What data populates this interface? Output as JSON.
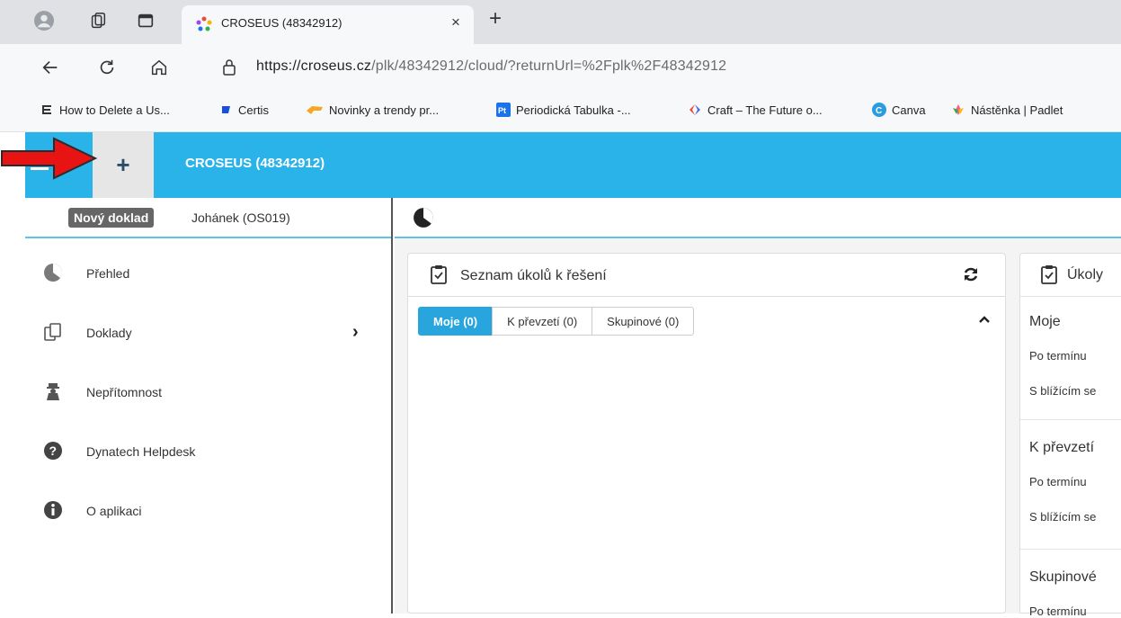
{
  "browser": {
    "tab_title": "CROSEUS (48342912)",
    "tab_close": "×",
    "new_tab": "+",
    "url_host": "https://croseus.cz",
    "url_path": "/plk/48342912/cloud/?returnUrl=%2Fplk%2F48342912",
    "bookmarks": [
      {
        "label": "How to Delete a Us...",
        "icon": "e-icon"
      },
      {
        "label": "Certis",
        "icon": "blue-flag-icon"
      },
      {
        "label": "Novinky a trendy pr...",
        "icon": "hand-icon"
      },
      {
        "label": "Periodická Tabulka -...",
        "icon": "pt-icon"
      },
      {
        "label": "Craft – The Future o...",
        "icon": "craft-icon"
      },
      {
        "label": "Canva",
        "icon": "canva-icon"
      },
      {
        "label": "Nástěnka | Padlet",
        "icon": "padlet-icon"
      }
    ]
  },
  "app": {
    "header_title": "CROSEUS (48342912)",
    "plus_label": "+",
    "tooltip": "Nový doklad",
    "user": "Johánek (OS019)",
    "accent": "#29b3e8",
    "sidebar": [
      {
        "label": "Přehled",
        "icon": "overview-icon"
      },
      {
        "label": "Doklady",
        "icon": "documents-icon",
        "chevron": "›"
      },
      {
        "label": "Nepřítomnost",
        "icon": "absence-icon"
      },
      {
        "label": "Dynatech Helpdesk",
        "icon": "help-icon"
      },
      {
        "label": "O aplikaci",
        "icon": "info-icon"
      }
    ]
  },
  "tasks_panel": {
    "title": "Seznam úkolů k řešení",
    "tabs": [
      "Moje (0)",
      "K převzetí (0)",
      "Skupinové (0)"
    ]
  },
  "side_panel": {
    "title": "Úkoly",
    "groups": [
      {
        "heading": "Moje",
        "items": [
          "Po termínu",
          "S blížícím se"
        ]
      },
      {
        "heading": "K převzetí",
        "items": [
          "Po termínu",
          "S blížícím se"
        ]
      },
      {
        "heading": "Skupinové",
        "items": [
          "Po termínu"
        ]
      }
    ]
  }
}
